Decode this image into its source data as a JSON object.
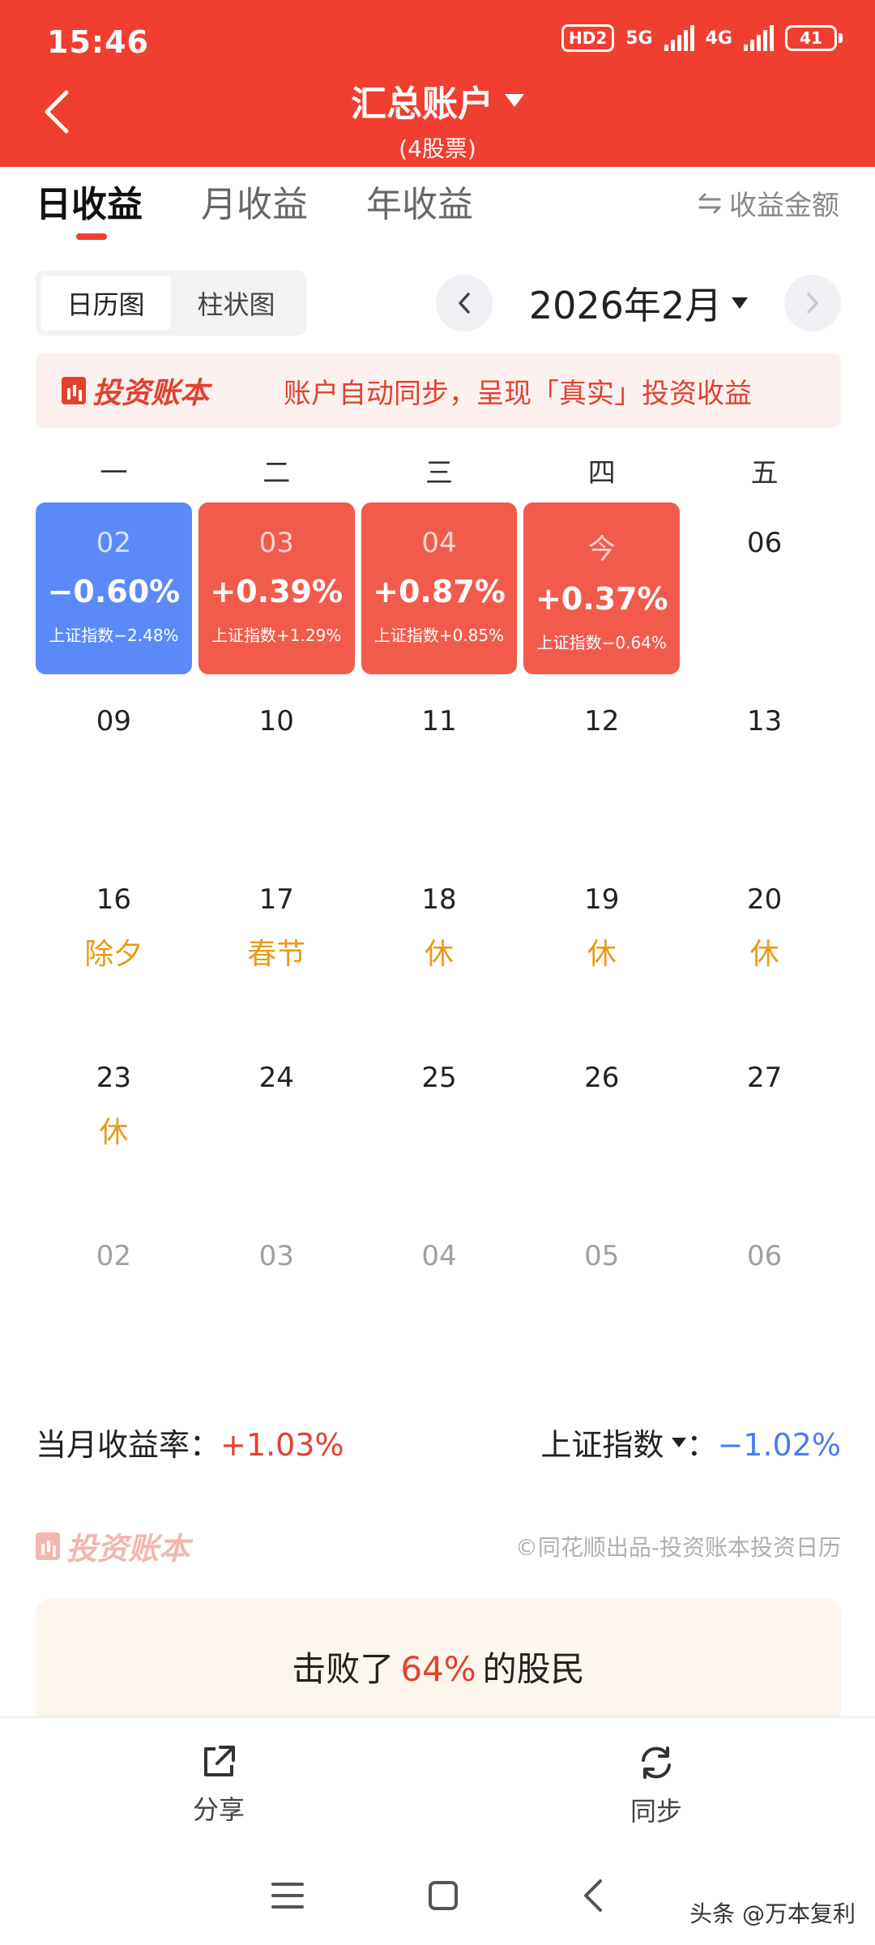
{
  "status_bar": {
    "time": "15:46",
    "hd": "HD2",
    "net1": "5G",
    "net2": "4G",
    "battery": "41"
  },
  "header": {
    "title": "汇总账户",
    "subtitle": "(4股票)"
  },
  "tabs": [
    {
      "label": "日收益",
      "active": true
    },
    {
      "label": "月收益",
      "active": false
    },
    {
      "label": "年收益",
      "active": false
    }
  ],
  "toggle_amount": "收益金额",
  "view_switch": {
    "calendar": "日历图",
    "bar": "柱状图"
  },
  "month": "2026年2月",
  "banner": {
    "brand": "投资账本",
    "text": "账户自动同步，呈现「真实」投资收益"
  },
  "weekdays": [
    "一",
    "二",
    "三",
    "四",
    "五"
  ],
  "calendar_rows": [
    [
      {
        "date": "02",
        "pct": "−0.60%",
        "idx": "上证指数−2.48%",
        "style": "blue"
      },
      {
        "date": "03",
        "pct": "+0.39%",
        "idx": "上证指数+1.29%",
        "style": "red"
      },
      {
        "date": "04",
        "pct": "+0.87%",
        "idx": "上证指数+0.85%",
        "style": "red"
      },
      {
        "date": "今",
        "pct": "+0.37%",
        "idx": "上证指数−0.64%",
        "style": "red"
      },
      {
        "date": "06",
        "style": "plain"
      }
    ],
    [
      {
        "date": "09",
        "style": "plain"
      },
      {
        "date": "10",
        "style": "plain"
      },
      {
        "date": "11",
        "style": "plain"
      },
      {
        "date": "12",
        "style": "plain"
      },
      {
        "date": "13",
        "style": "plain"
      }
    ],
    [
      {
        "date": "16",
        "holiday": "除夕",
        "style": "plain"
      },
      {
        "date": "17",
        "holiday": "春节",
        "style": "plain"
      },
      {
        "date": "18",
        "holiday": "休",
        "style": "plain"
      },
      {
        "date": "19",
        "holiday": "休",
        "style": "plain"
      },
      {
        "date": "20",
        "holiday": "休",
        "style": "plain"
      }
    ],
    [
      {
        "date": "23",
        "holiday": "休",
        "style": "plain"
      },
      {
        "date": "24",
        "style": "plain"
      },
      {
        "date": "25",
        "style": "plain"
      },
      {
        "date": "26",
        "style": "plain"
      },
      {
        "date": "27",
        "style": "plain"
      }
    ],
    [
      {
        "date": "02",
        "style": "gray"
      },
      {
        "date": "03",
        "style": "gray"
      },
      {
        "date": "04",
        "style": "gray"
      },
      {
        "date": "05",
        "style": "gray"
      },
      {
        "date": "06",
        "style": "gray"
      }
    ]
  ],
  "summary": {
    "month_rate_label": "当月收益率：",
    "month_rate_value": "+1.03%",
    "index_label": "上证指数",
    "index_sep": "：",
    "index_value": "−1.02%"
  },
  "footer": {
    "brand": "投资账本",
    "credit": "©同花顺出品-投资账本投资日历"
  },
  "beat": {
    "prefix": "击败了",
    "pct": "64%",
    "suffix": "的股民"
  },
  "actions": {
    "share": "分享",
    "sync": "同步"
  },
  "watermark": "头条 @万本复利",
  "colors": {
    "brand_red": "#f03e30",
    "loss_blue": "#5b8af8",
    "gain_red": "#f25b4c",
    "holiday_orange": "#e99a18"
  }
}
